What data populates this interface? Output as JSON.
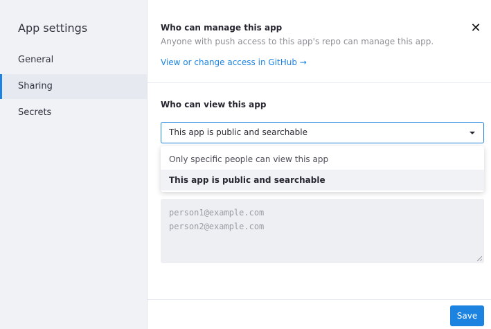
{
  "sidebar": {
    "title": "App settings",
    "items": [
      {
        "label": "General"
      },
      {
        "label": "Sharing"
      },
      {
        "label": "Secrets"
      }
    ]
  },
  "manage": {
    "title": "Who can manage this app",
    "description": "Anyone with push access to this app's repo can manage this app.",
    "link_label": "View or change access in GitHub →"
  },
  "view": {
    "title": "Who can view this app",
    "selected": "This app is public and searchable",
    "options": [
      {
        "label": "Only specific people can view this app"
      },
      {
        "label": "This app is public and searchable"
      }
    ],
    "emails_placeholder_line1": "person1@example.com",
    "emails_placeholder_line2": "person2@example.com"
  },
  "actions": {
    "close_glyph": "✕",
    "save_label": "Save"
  },
  "colors": {
    "accent": "#1c83e1",
    "sidebar_bg": "#f0f2f6"
  }
}
